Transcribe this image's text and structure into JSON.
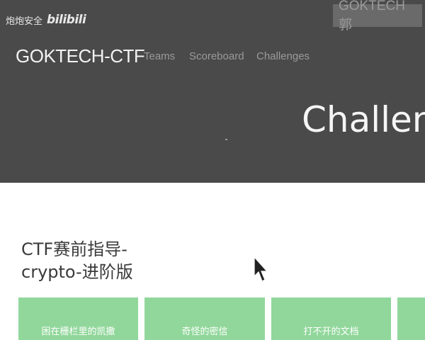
{
  "watermark": {
    "channel_cn": "炮炮安全",
    "platform": "bilibili",
    "overlay_text": "GOKTECH 郭"
  },
  "navbar": {
    "brand": "GOKTECH-CTF",
    "items": [
      {
        "label": "Teams"
      },
      {
        "label": "Scoreboard"
      },
      {
        "label": "Challenges"
      }
    ]
  },
  "hero": {
    "title": "Challen"
  },
  "category": {
    "title_line1": "CTF赛前指导-",
    "title_line2": "crypto-进阶版"
  },
  "challenges": [
    {
      "label": "困在栅栏里的凯撒"
    },
    {
      "label": "奇怪的密信"
    },
    {
      "label": "打不开的文档"
    },
    {
      "label": ""
    }
  ],
  "colors": {
    "header_bg": "#4a4a4a",
    "card_bg": "#91d79b",
    "nav_text": "#9a9a9a",
    "page_bg": "#ffffff"
  }
}
